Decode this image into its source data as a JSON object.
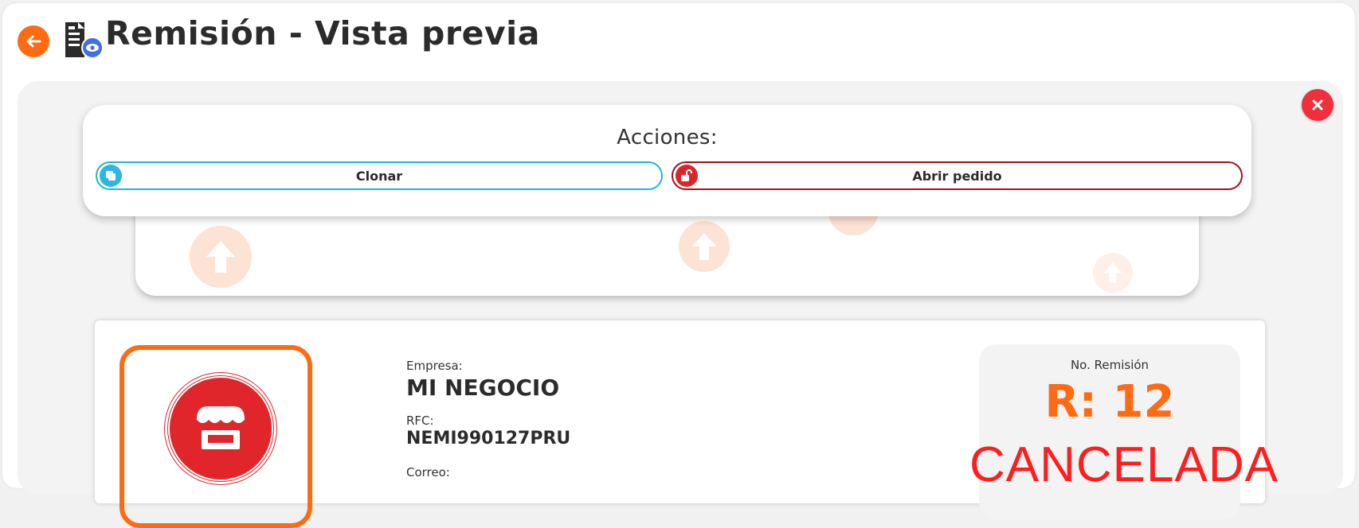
{
  "header": {
    "title": "Remisión - Vista previa",
    "back_icon": "arrow-left-icon",
    "doc_icon": "document-preview-icon"
  },
  "actions": {
    "title": "Acciones:",
    "clone_label": "Clonar",
    "open_order_label": "Abrir pedido",
    "clone_icon": "copy-icon",
    "open_icon": "unlock-icon"
  },
  "document": {
    "company_label": "Empresa:",
    "company_name": "MI NEGOCIO",
    "rfc_label": "RFC:",
    "rfc_value": "NEMI990127PRU",
    "email_label": "Correo:",
    "number_label": "No. Remisión",
    "number_value": "R: 12",
    "status": "CANCELADA",
    "logo_icon": "store-icon"
  },
  "colors": {
    "accent": "#ff6a13",
    "close": "#ef2f3c",
    "clone_border": "#1bb8d6",
    "open_border": "#a40f18",
    "status": "#ff1e1e"
  }
}
